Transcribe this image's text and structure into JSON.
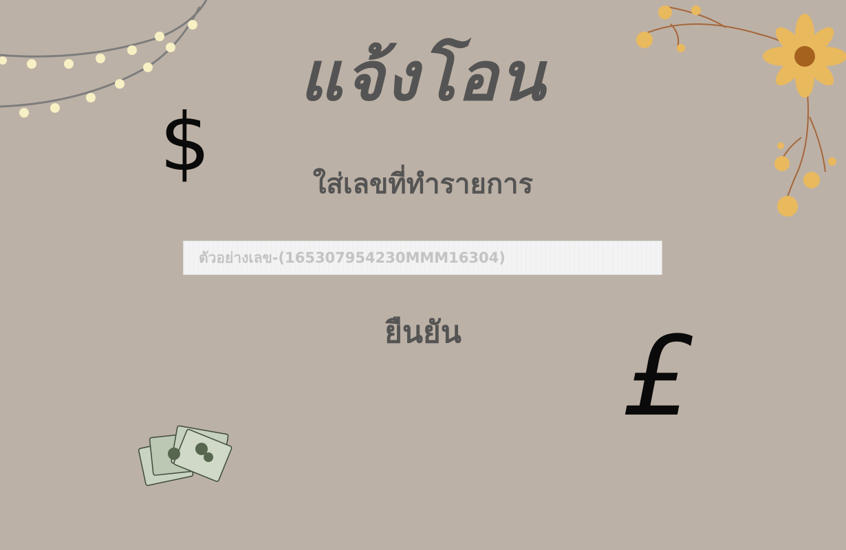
{
  "page": {
    "title": "แจ้งโอน",
    "subtitle": "ใส่เลขที่ทำรายการ",
    "transaction_input": {
      "placeholder": "ตัวอย่างเลข-(165307954230MMM16304)",
      "value": ""
    },
    "confirm_label": "ยืนยัน"
  },
  "decor": {
    "dollar_symbol": "$",
    "pound_symbol": "£",
    "string_lights_icon": "string-lights",
    "flower_icon": "flower-branch",
    "money_icon": "cash-stack"
  },
  "colors": {
    "background": "#bcb1a6",
    "heading": "#545454",
    "input_bg": "#f3f3f3",
    "flower": "#e9b95e"
  }
}
